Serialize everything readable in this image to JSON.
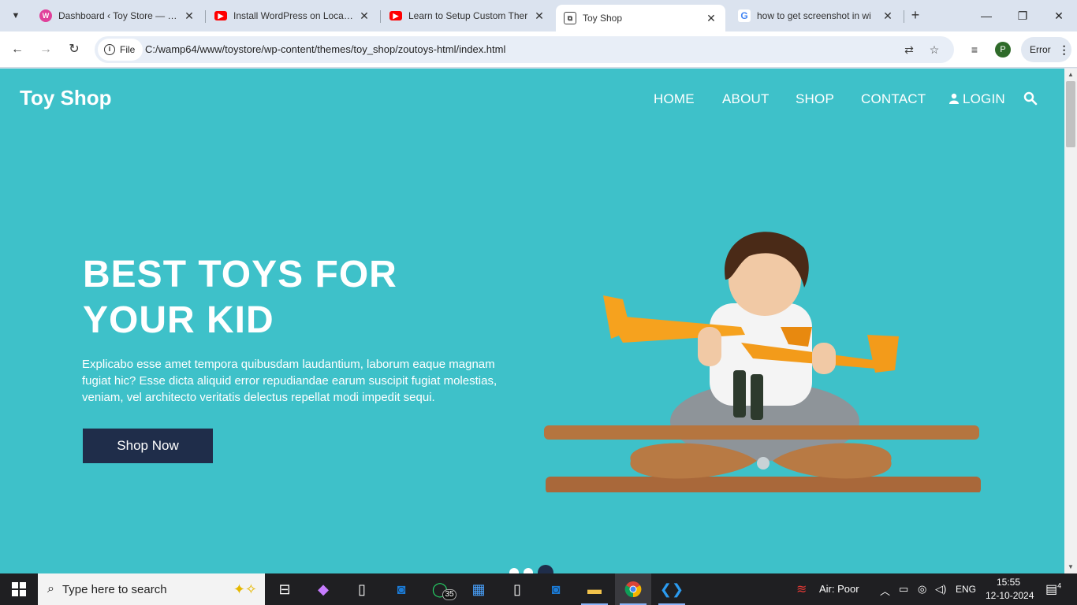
{
  "browser": {
    "tabs": [
      {
        "title": "Dashboard ‹ Toy Store — Wo",
        "icon": "wordpress-icon",
        "active": false
      },
      {
        "title": "Install WordPress on Localho",
        "icon": "youtube-icon",
        "active": false
      },
      {
        "title": "Learn to Setup Custom Ther",
        "icon": "youtube-icon",
        "active": false
      },
      {
        "title": "Toy Shop",
        "icon": "page-icon",
        "active": true
      },
      {
        "title": "how to get screenshot in wi",
        "icon": "google-icon",
        "active": false
      }
    ],
    "address": {
      "chip_label": "File",
      "url": "C:/wamp64/www/toystore/wp-content/themes/toy_shop/zoutoys-html/index.html"
    },
    "profile_initial": "P",
    "error_label": "Error"
  },
  "page": {
    "brand": "Toy Shop",
    "nav": [
      {
        "label": "HOME"
      },
      {
        "label": "ABOUT"
      },
      {
        "label": "SHOP"
      },
      {
        "label": "CONTACT"
      },
      {
        "label": "LOGIN"
      }
    ],
    "hero": {
      "title_line1": "BEST TOYS FOR",
      "title_line2": "YOUR KID",
      "text": "Explicabo esse amet tempora quibusdam laudantium, laborum eaque magnam fugiat hic? Esse dicta aliquid error repudiandae earum suscipit fugiat molestias, veniam, vel architecto veritatis delectus repellat modi impedit sequi.",
      "cta": "Shop Now"
    },
    "carousel": {
      "slides": 3,
      "active_index": 2
    },
    "colors": {
      "hero_bg": "#3ec1c9",
      "button_bg": "#1f2d4a"
    }
  },
  "taskbar": {
    "search_placeholder": "Type here to search",
    "whatsapp_badge": "35",
    "weather": "Air: Poor",
    "language": "ENG",
    "time": "15:55",
    "date": "12-10-2024",
    "notifications": "4"
  }
}
